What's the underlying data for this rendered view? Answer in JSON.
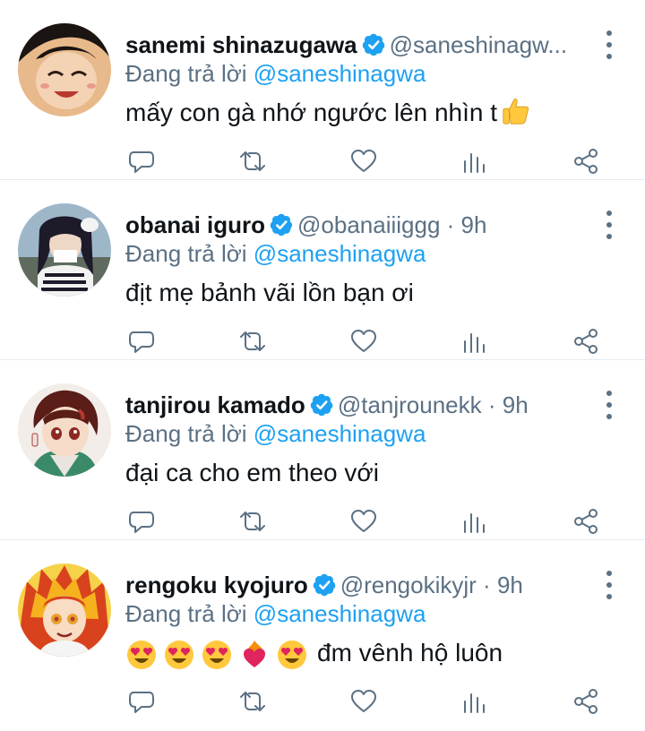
{
  "tweets": [
    {
      "name": "sanemi shinazugawa",
      "handle": "@saneshinagw...",
      "sep": "",
      "time": "",
      "reply_prefix": "Đang trả lời",
      "reply_mention": "@saneshinagwa",
      "text": "mấy con gà nhớ ngước lên nhìn t",
      "text_emoji": "thumbs-up",
      "avatar": {
        "bg": "#e8b98a",
        "hair": "#1a1412"
      }
    },
    {
      "name": "obanai iguro",
      "handle": "@obanaiiiggg",
      "sep": "·",
      "time": "9h",
      "reply_prefix": "Đang trả lời",
      "reply_mention": "@saneshinagwa",
      "text": "địt mẹ bảnh vãi lồn bạn ơi",
      "avatar": {
        "bg": "#9db7c9",
        "hair": "#1d1a2a"
      }
    },
    {
      "name": "tanjirou kamado",
      "handle": "@tanjrounekk",
      "sep": "·",
      "time": "9h",
      "reply_prefix": "Đang trả lời",
      "reply_mention": "@saneshinagwa",
      "text": "đại ca cho em theo với",
      "avatar": {
        "bg": "#f2ede8",
        "hair": "#5a1d18"
      }
    },
    {
      "name": "rengoku kyojuro",
      "handle": "@rengokikyjr",
      "sep": "·",
      "time": "9h",
      "reply_prefix": "Đang trả lời",
      "reply_mention": "@saneshinagwa",
      "text": "đm vênh hộ luôn",
      "text_emojis": [
        "heart-eyes",
        "heart-eyes",
        "heart-eyes",
        "heart-on-fire",
        "heart-eyes"
      ],
      "avatar": {
        "bg": "#f6d24a",
        "hair": "#d8431e"
      }
    }
  ],
  "colors": {
    "accent": "#1da1f2",
    "muted": "#5b7083",
    "text": "#0f1419",
    "divider": "#e6ecf0"
  }
}
